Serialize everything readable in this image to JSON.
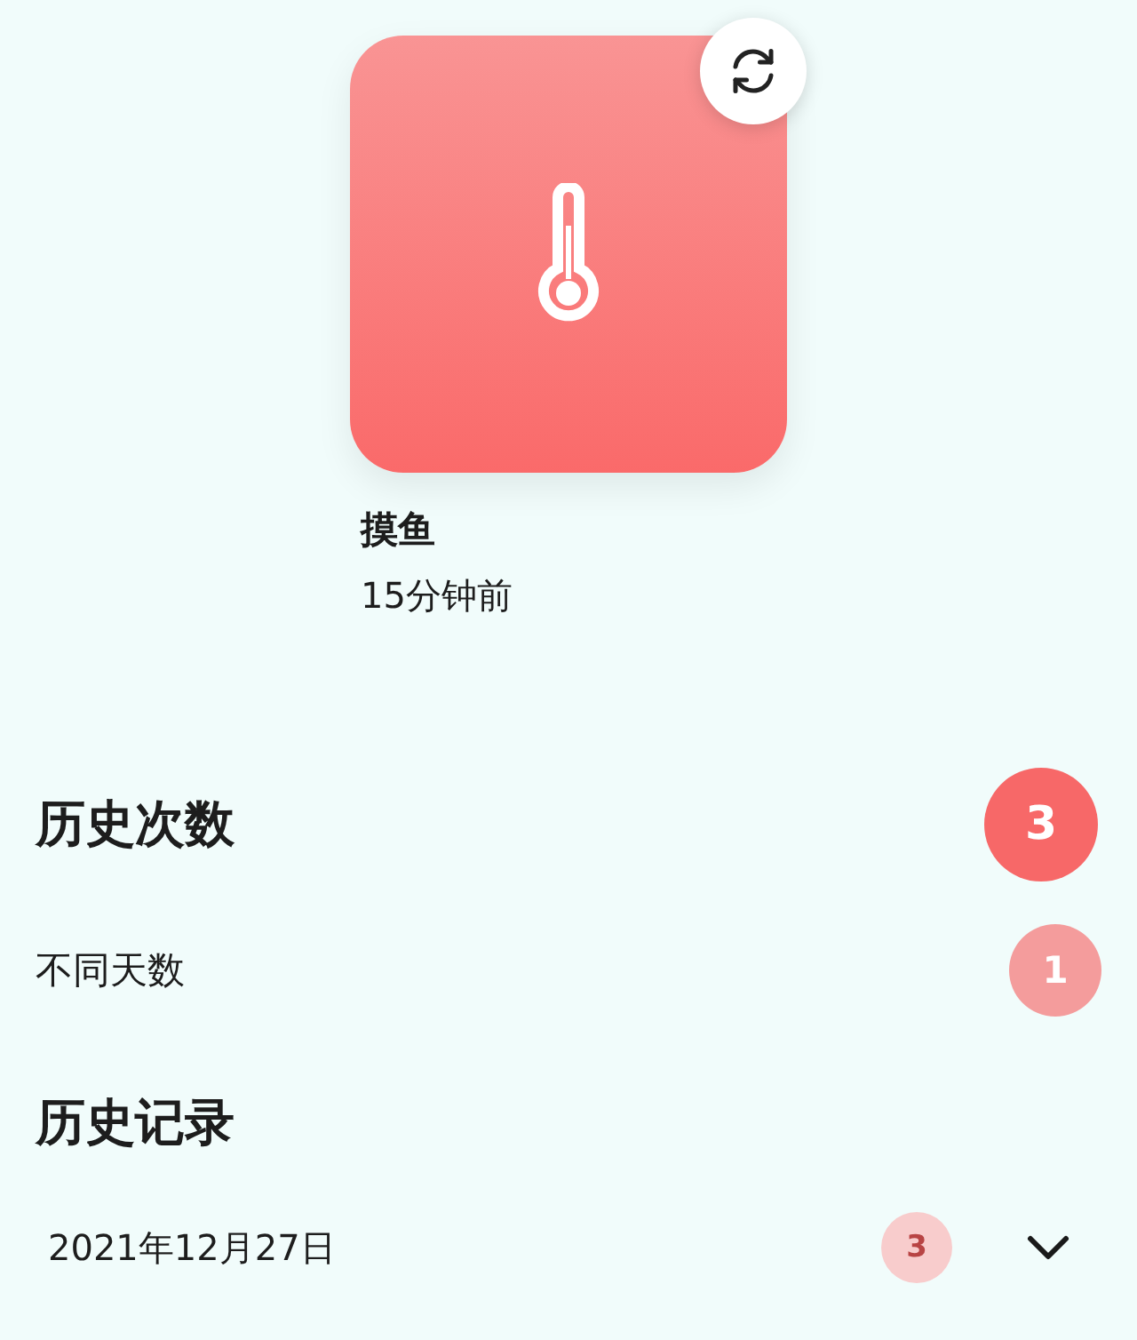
{
  "item": {
    "name": "摸鱼",
    "time": "15分钟前"
  },
  "stats": [
    {
      "label": "历史次数",
      "kind": "major",
      "count": "3",
      "color": "#f76868"
    },
    {
      "label": "不同天数",
      "kind": "minor",
      "count": "1",
      "color": "#f49c9c"
    }
  ],
  "history": {
    "title": "历史记录",
    "entries": [
      {
        "date": "2021年12月27日",
        "count": "3",
        "color": "#f8cccc",
        "expanded": false
      }
    ]
  }
}
